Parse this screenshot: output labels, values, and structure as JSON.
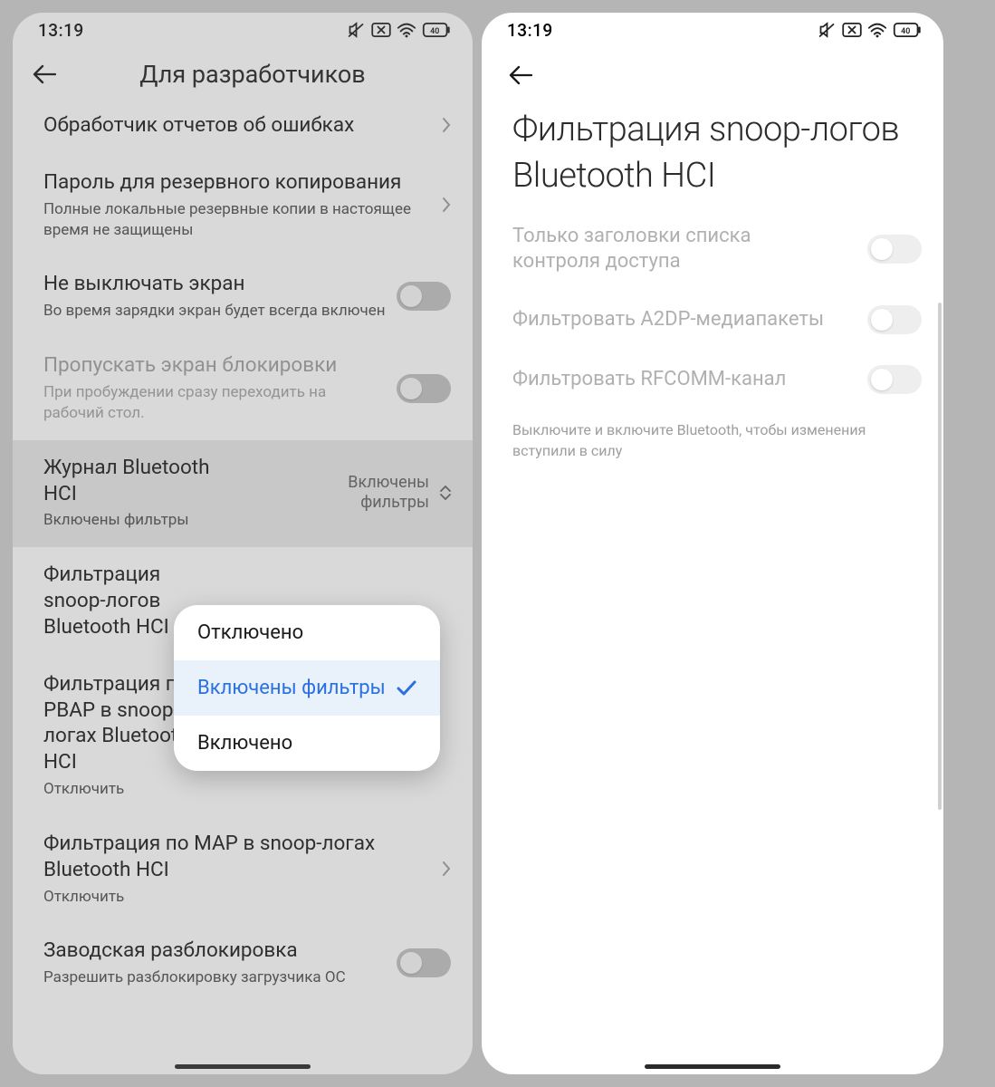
{
  "status": {
    "time": "13:19",
    "battery": "40"
  },
  "left": {
    "header_title": "Для разработчиков",
    "rows": {
      "bugreport": {
        "label": "Обработчик отчетов об ошибках"
      },
      "backuppw": {
        "label": "Пароль для резервного копирования",
        "sub": "Полные локальные резервные копии в настоящее время не защищены"
      },
      "stayawake": {
        "label": "Не выключать экран",
        "sub": "Во время зарядки экран будет всегда включен"
      },
      "skiplock": {
        "label": "Пропускать экран блокировки",
        "sub": "При пробуждении сразу переходить на рабочий стол."
      },
      "bthci": {
        "label": "Журнал Bluetooth HCI",
        "sub": "Включены фильтры",
        "value": "Включены фильтры"
      },
      "snoopfilter": {
        "label": "Фильтрация snoop-логов Bluetooth HCI"
      },
      "pbapfilter": {
        "label": "Фильтрация по PBAP в snoop-логах Bluetooth HCI",
        "sub": "Отключить"
      },
      "mapfilter": {
        "label": "Фильтрация по MAP в snoop-логах Bluetooth HCI",
        "sub": "Отключить"
      },
      "oemunlock": {
        "label": "Заводская разблокировка",
        "sub": "Разрешить разблокировку загрузчика ОС"
      }
    },
    "popup": {
      "opt1": "Отключено",
      "opt2": "Включены фильтры",
      "opt3": "Включено"
    }
  },
  "right": {
    "big_title": "Фильтрация snoop-логов Bluetooth HCI",
    "rows": {
      "acl": {
        "label": "Только заголовки списка контроля доступа"
      },
      "a2dp": {
        "label": "Фильтровать A2DP-медиапакеты"
      },
      "rfcomm": {
        "label": "Фильтровать RFCOMM-канал"
      }
    },
    "hint": "Выключите и включите Bluetooth, чтобы изменения вступили в силу"
  }
}
